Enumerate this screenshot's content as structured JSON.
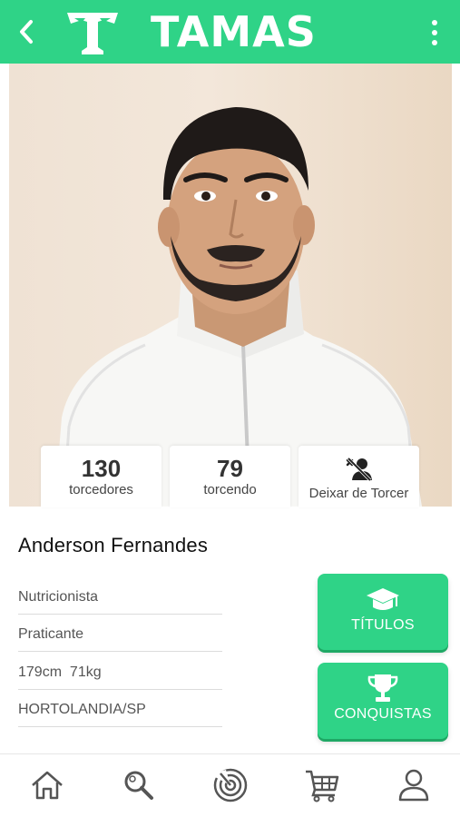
{
  "header": {
    "back_icon": "chevron-left-icon",
    "logo_letter": "T",
    "brand": "TAMAS",
    "menu_icon": "vertical-dots-icon",
    "color": "#2fd387"
  },
  "stats": {
    "followers": {
      "value": "130",
      "label": "torcedores"
    },
    "following": {
      "value": "79",
      "label": "torcendo"
    },
    "unfollow": {
      "label": "Deixar de Torcer",
      "icon": "unfollow-user-icon"
    }
  },
  "profile": {
    "name": "Anderson Fernandes",
    "profession": "Nutricionista",
    "level": "Praticante",
    "measures": "179cm  71kg",
    "location": "HORTOLANDIA/SP"
  },
  "actions": {
    "titles": {
      "label": "TÍTULOS",
      "icon": "graduation-cap-icon"
    },
    "achievements": {
      "label": "CONQUISTAS",
      "icon": "trophy-icon"
    }
  },
  "bottom_nav": [
    {
      "icon": "home-icon"
    },
    {
      "icon": "search-icon"
    },
    {
      "icon": "radar-icon"
    },
    {
      "icon": "cart-icon"
    },
    {
      "icon": "profile-icon"
    }
  ]
}
